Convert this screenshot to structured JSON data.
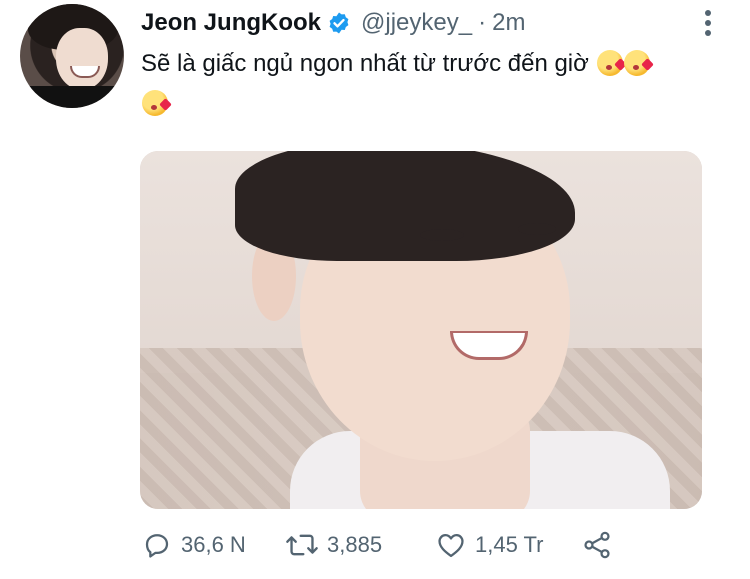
{
  "tweet": {
    "author": {
      "display_name": "Jeon JungKook",
      "verified": true,
      "handle": "@jjeykey_",
      "separator": "·",
      "time": "2m"
    },
    "text": "Sẽ là giấc ngủ ngon nhất từ trước đến giờ",
    "emoji": [
      "face-blowing-a-kiss",
      "face-blowing-a-kiss",
      "face-blowing-a-kiss"
    ],
    "actions": {
      "replies": "36,6 N",
      "retweets": "3,885",
      "likes": "1,45 Tr"
    }
  },
  "colors": {
    "text": "#0f1419",
    "secondary": "#536471",
    "verified": "#1d9bf0"
  },
  "icons": [
    "more-vertical-icon",
    "reply-icon",
    "retweet-icon",
    "like-icon",
    "share-icon",
    "verified-badge-icon"
  ]
}
